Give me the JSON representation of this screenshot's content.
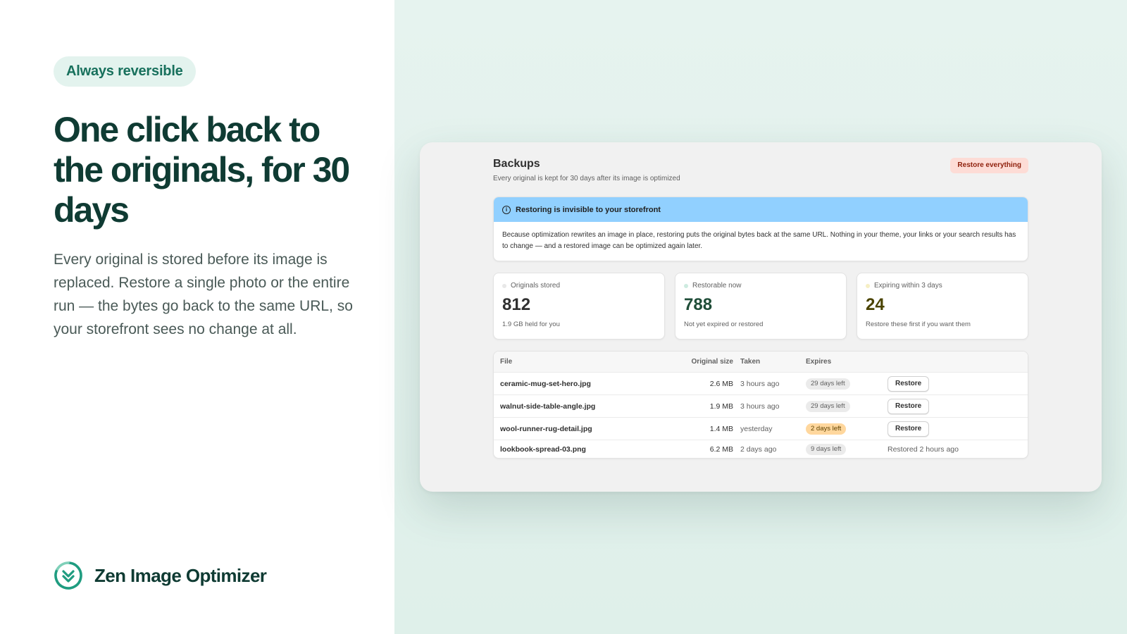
{
  "hero": {
    "pill": "Always reversible",
    "headline": "One click back to the originals, for 30 days",
    "lede": "Every original is stored before its image is replaced. Restore a single photo or the entire run — the bytes go back to the same URL, so your storefront sees no change at all.",
    "brand": "Zen Image Optimizer"
  },
  "backups": {
    "title": "Backups",
    "subtitle": "Every original is kept for 30 days after its image is optimized",
    "restore_all": "Restore everything"
  },
  "banner": {
    "title": "Restoring is invisible to your storefront",
    "body": "Because optimization rewrites an image in place, restoring puts the original bytes back at the same URL. Nothing in your theme, your links or your search results has to change — and a restored image can be optimized again later."
  },
  "cards": [
    {
      "label": "Originals stored",
      "value": "812",
      "foot": "1.9 GB held for you",
      "dot": "#e8e8e8",
      "value_color": "#303030"
    },
    {
      "label": "Restorable now",
      "value": "788",
      "foot": "Not yet expired or restored",
      "dot": "#cdebe0",
      "value_color": "#1f4d38"
    },
    {
      "label": "Expiring within 3 days",
      "value": "24",
      "foot": "Restore these first if you want them",
      "dot": "#f6efc4",
      "value_color": "#4a4300"
    }
  ],
  "table": {
    "headers": {
      "file": "File",
      "size": "Original size",
      "taken": "Taken",
      "expires": "Expires"
    },
    "rows": [
      {
        "file": "ceramic-mug-set-hero.jpg",
        "size": "2.6 MB",
        "taken": "3 hours ago",
        "expires": "29 days left",
        "action": "Restore"
      },
      {
        "file": "walnut-side-table-angle.jpg",
        "size": "1.9 MB",
        "taken": "3 hours ago",
        "expires": "29 days left",
        "action": "Restore"
      },
      {
        "file": "wool-runner-rug-detail.jpg",
        "size": "1.4 MB",
        "taken": "yesterday",
        "expires": "2 days left",
        "action": "Restore"
      },
      {
        "file": "lookbook-spread-03.png",
        "size": "6.2 MB",
        "taken": "2 days ago",
        "expires": "9 days left",
        "status": "Restored 2 hours ago"
      }
    ]
  },
  "colors": {
    "accent": "#17705c",
    "brand_dark": "#0f3b33",
    "banner_blue": "#91d0ff",
    "critical": "#8e1f0b",
    "warning_badge": "#ffd79d"
  }
}
